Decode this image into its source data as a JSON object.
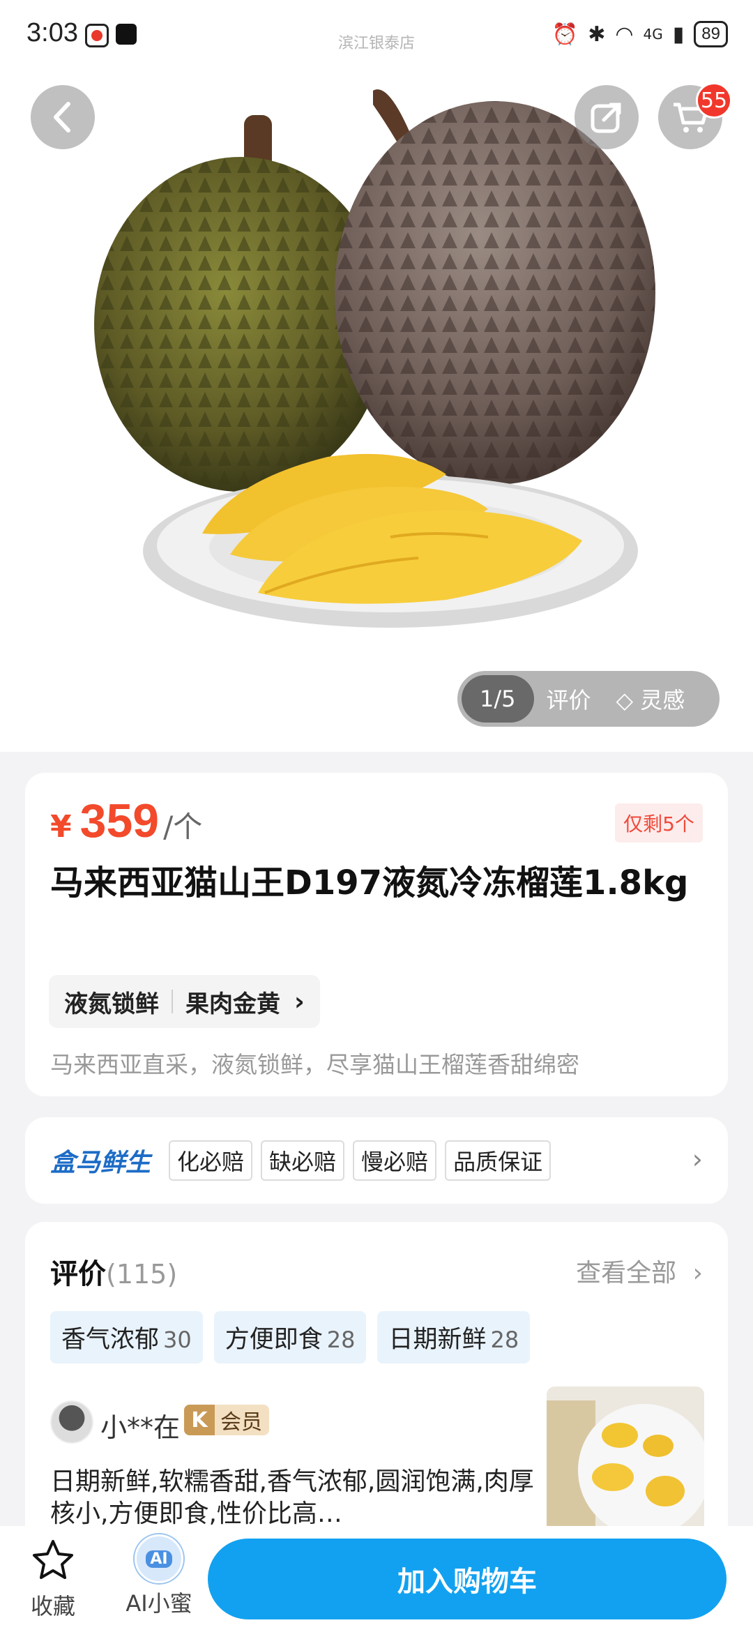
{
  "status_bar": {
    "time": "3:03",
    "store_name": "滨江银泰店",
    "network": "4G",
    "battery": "89"
  },
  "header": {
    "cart_count": "55"
  },
  "gallery": {
    "counter": "1/5",
    "tab_review": "评价",
    "tab_inspiration": "◇ 灵感"
  },
  "product": {
    "currency": "¥",
    "price": "359",
    "unit": "/个",
    "stock": "仅剩5个",
    "title": "马来西亚猫山王D197液氮冷冻榴莲1.8kg",
    "tags": [
      "液氮锁鲜",
      "果肉金黄"
    ],
    "description": "马来西亚直采，液氮锁鲜，尽享猫山王榴莲香甜绵密"
  },
  "promise": {
    "brand": "盒马鲜生",
    "items": [
      "化必赔",
      "缺必赔",
      "慢必赔",
      "品质保证"
    ]
  },
  "reviews": {
    "title": "评价",
    "count": "(115)",
    "view_all": "查看全部",
    "keywords": [
      {
        "label": "香气浓郁",
        "count": "30"
      },
      {
        "label": "方便即食",
        "count": "28"
      },
      {
        "label": "日期新鲜",
        "count": "28"
      }
    ],
    "first": {
      "user": "小**在",
      "member_label": "会员",
      "member_icon": "K",
      "text": "日期新鲜,软糯香甜,香气浓郁,圆润饱满,肉厚核小,方便即食,性价比高…"
    }
  },
  "bottom_bar": {
    "favorite": "收藏",
    "ai_assistant": "AI小蜜",
    "ai_badge": "AI",
    "add_to_cart": "加入购物车"
  },
  "colors": {
    "price": "#f24a2b",
    "primary_button": "#12a1f0",
    "brand": "#1d6cc6",
    "badge": "#f1372c"
  }
}
